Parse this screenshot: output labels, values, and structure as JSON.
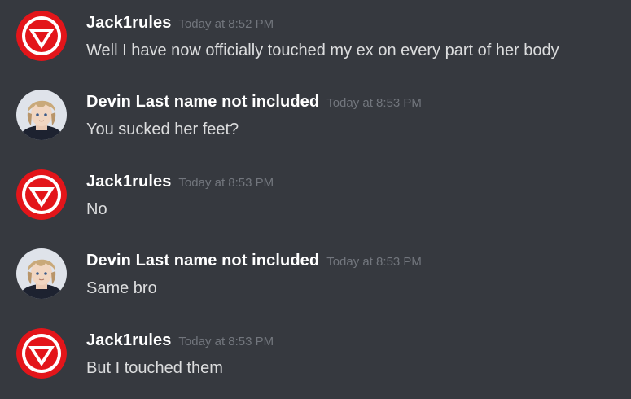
{
  "messages": [
    {
      "author": "Jack1rules",
      "avatar": "red-v-logo-icon",
      "timestamp": "Today at 8:52 PM",
      "text": "Well I have now officially touched my ex on every part of her body"
    },
    {
      "author": "Devin Last name not included",
      "avatar": "anime-character-icon",
      "timestamp": "Today at 8:53 PM",
      "text": "You sucked her feet?"
    },
    {
      "author": "Jack1rules",
      "avatar": "red-v-logo-icon",
      "timestamp": "Today at 8:53 PM",
      "text": "No"
    },
    {
      "author": "Devin Last name not included",
      "avatar": "anime-character-icon",
      "timestamp": "Today at 8:53 PM",
      "text": "Same bro"
    },
    {
      "author": "Jack1rules",
      "avatar": "red-v-logo-icon",
      "timestamp": "Today at 8:53 PM",
      "text": "But I touched them"
    }
  ],
  "colors": {
    "background": "#36393f",
    "username": "#ffffff",
    "timestamp": "#72767d",
    "message_text": "#dcddde",
    "logo_red": "#e3151a"
  }
}
